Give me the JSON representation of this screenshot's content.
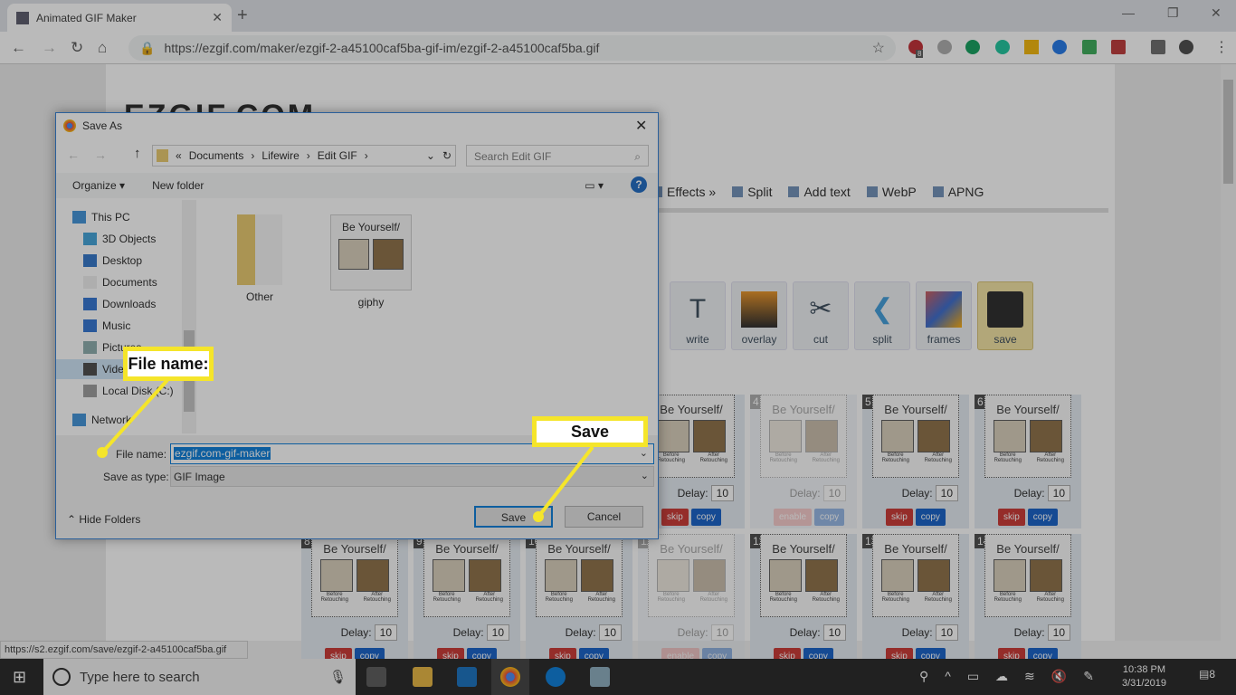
{
  "browser": {
    "tab_title": "Animated GIF Maker",
    "url": "https://ezgif.com/maker/ezgif-2-a45100caf5ba-gif-im/ezgif-2-a45100caf5ba.gif",
    "adblock_badge": "8",
    "status_url": "https://s2.ezgif.com/save/ezgif-2-a45100caf5ba.gif"
  },
  "site": {
    "logo": "EZGIF.COM",
    "menu": [
      "Effects »",
      "Split",
      "Add text",
      "WebP",
      "APNG"
    ],
    "tools": [
      {
        "label": "write",
        "icon": "text-icon"
      },
      {
        "label": "overlay",
        "icon": "overlay-icon"
      },
      {
        "label": "cut",
        "icon": "scissors-icon"
      },
      {
        "label": "split",
        "icon": "split-icon"
      },
      {
        "label": "frames",
        "icon": "frames-icon"
      },
      {
        "label": "save",
        "icon": "floppy-icon"
      }
    ],
    "frame_text": {
      "title": "Be Yourself/",
      "before": "Before Retouching",
      "after": "After Retouching",
      "delay_label": "Delay:",
      "delay": "10",
      "skip": "skip",
      "copy": "copy",
      "enable": "enable"
    },
    "row1": [
      {
        "num": "",
        "disabled": false
      },
      {
        "num": "4",
        "disabled": true
      },
      {
        "num": "5",
        "disabled": false
      },
      {
        "num": "6",
        "disabled": false
      }
    ],
    "row2": [
      {
        "num": "8",
        "disabled": false
      },
      {
        "num": "9",
        "disabled": false
      },
      {
        "num": "10",
        "disabled": false
      },
      {
        "num": "11",
        "disabled": true
      },
      {
        "num": "12",
        "disabled": false
      },
      {
        "num": "13",
        "disabled": false
      },
      {
        "num": "14",
        "disabled": false
      }
    ]
  },
  "dialog": {
    "title": "Save As",
    "breadcrumb": [
      "«",
      "Documents",
      "›",
      "Lifewire",
      "›",
      "Edit GIF",
      "›"
    ],
    "search_placeholder": "Search Edit GIF",
    "organize": "Organize ▾",
    "new_folder": "New folder",
    "tree": [
      "This PC",
      "3D Objects",
      "Desktop",
      "Documents",
      "Downloads",
      "Music",
      "Pictures",
      "Videos",
      "Local Disk (C:)",
      "Network"
    ],
    "files": [
      "Other",
      "giphy"
    ],
    "file_name_label": "File name:",
    "file_name": "ezgif.com-gif-maker",
    "type_label": "Save as type:",
    "type": "GIF Image",
    "save": "Save",
    "cancel": "Cancel",
    "hide_folders": "Hide Folders"
  },
  "callouts": {
    "file_name": "File name:",
    "save": "Save",
    "color": "#f5e52a"
  },
  "taskbar": {
    "search_placeholder": "Type here to search",
    "time": "10:38 PM",
    "date": "3/31/2019",
    "notifications": "8"
  }
}
